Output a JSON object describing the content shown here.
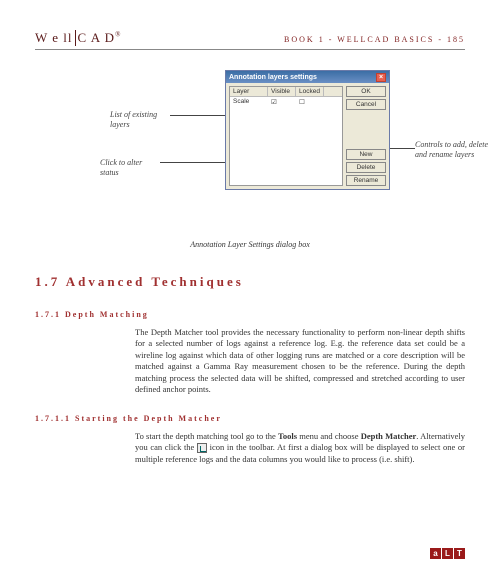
{
  "header": {
    "logo_prefix": "W e l",
    "logo_l": "l",
    "logo_cad": "C A D",
    "logo_reg": "®",
    "page_ref": "BOOK 1 - WELLCAD BASICS - 185"
  },
  "callouts": {
    "list": "List of existing layers",
    "click": "Click to alter status",
    "controls": "Controls to add, delete and rename layers"
  },
  "dialog": {
    "title": "Annotation layers settings",
    "columns": [
      "Layer",
      "Visible",
      "Locked"
    ],
    "row_layer": "Scale",
    "row_vis": "☑",
    "row_lock": "☐",
    "buttons": {
      "ok": "OK",
      "cancel": "Cancel",
      "new": "New",
      "delete": "Delete",
      "rename": "Rename"
    }
  },
  "figure_caption": "Annotation Layer Settings dialog box",
  "section_title": "1.7 Advanced Techniques",
  "sub1": "1.7.1 Depth Matching",
  "para1": "The Depth Matcher tool provides the necessary functionality to perform non-linear depth shifts for a selected number of logs against a reference log. E.g. the reference data set could be a wireline log against which data of other logging runs are matched or a core description will be matched against a Gamma Ray measurement chosen to be the reference. During the depth matching process the selected data will be shifted, compressed and stretched according to user defined anchor points.",
  "sub2": "1.7.1.1 Starting the Depth Matcher",
  "para2_a": "To start the depth matching tool go to the ",
  "para2_tools": "Tools",
  "para2_b": " menu and choose ",
  "para2_dm": "Depth Matcher",
  "para2_c": ". Alternatively you can click the ",
  "para2_d": " icon in the toolbar. At first a dialog box will be displayed to select one or multiple reference logs and the data columns you would like to process (i.e. shift).",
  "footer": {
    "a": "a",
    "l": "L",
    "t": "T"
  }
}
